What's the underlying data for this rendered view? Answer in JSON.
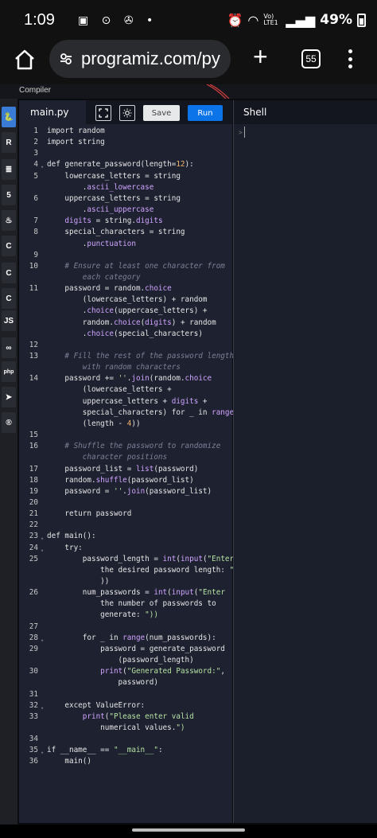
{
  "status_bar": {
    "time": "1:09",
    "left_icons": "▣ ⊙ ✇ •",
    "network": "Vo) LTE1",
    "battery": "49%"
  },
  "browser": {
    "url": "programiz.com/py",
    "tab_count": "55"
  },
  "compiler_label": "Compiler",
  "editor": {
    "file_tab": "main.py",
    "save_label": "Save",
    "run_label": "Run",
    "lines": [
      {
        "n": "1",
        "t": "import random"
      },
      {
        "n": "2",
        "t": "import string"
      },
      {
        "n": "3",
        "t": ""
      },
      {
        "n": "4",
        "t": "def generate_password(length=12):",
        "fold": true
      },
      {
        "n": "5",
        "t": "    lowercase_letters = string"
      },
      {
        "n": "",
        "t": "        .ascii_lowercase"
      },
      {
        "n": "6",
        "t": "    uppercase_letters = string"
      },
      {
        "n": "",
        "t": "        .ascii_uppercase"
      },
      {
        "n": "7",
        "t": "    digits = string.digits"
      },
      {
        "n": "8",
        "t": "    special_characters = string"
      },
      {
        "n": "",
        "t": "        .punctuation"
      },
      {
        "n": "9",
        "t": ""
      },
      {
        "n": "10",
        "t": "    # Ensure at least one character from"
      },
      {
        "n": "",
        "t": "        each category"
      },
      {
        "n": "11",
        "t": "    password = random.choice"
      },
      {
        "n": "",
        "t": "        (lowercase_letters) + random"
      },
      {
        "n": "",
        "t": "        .choice(uppercase_letters) +"
      },
      {
        "n": "",
        "t": "        random.choice(digits) + random"
      },
      {
        "n": "",
        "t": "        .choice(special_characters)"
      },
      {
        "n": "12",
        "t": ""
      },
      {
        "n": "13",
        "t": "    # Fill the rest of the password length"
      },
      {
        "n": "",
        "t": "        with random characters"
      },
      {
        "n": "14",
        "t": "    password += ''.join(random.choice"
      },
      {
        "n": "",
        "t": "        (lowercase_letters +"
      },
      {
        "n": "",
        "t": "        uppercase_letters + digits +"
      },
      {
        "n": "",
        "t": "        special_characters) for _ in range"
      },
      {
        "n": "",
        "t": "        (length - 4))"
      },
      {
        "n": "15",
        "t": ""
      },
      {
        "n": "16",
        "t": "    # Shuffle the password to randomize"
      },
      {
        "n": "",
        "t": "        character positions"
      },
      {
        "n": "17",
        "t": "    password_list = list(password)"
      },
      {
        "n": "18",
        "t": "    random.shuffle(password_list)"
      },
      {
        "n": "19",
        "t": "    password = ''.join(password_list)"
      },
      {
        "n": "20",
        "t": ""
      },
      {
        "n": "21",
        "t": "    return password"
      },
      {
        "n": "22",
        "t": ""
      },
      {
        "n": "23",
        "t": "def main():",
        "fold": true
      },
      {
        "n": "24",
        "t": "    try:",
        "fold": true
      },
      {
        "n": "25",
        "t": "        password_length = int(input(\"Enter"
      },
      {
        "n": "",
        "t": "            the desired password length: \""
      },
      {
        "n": "",
        "t": "            ))"
      },
      {
        "n": "26",
        "t": "        num_passwords = int(input(\"Enter"
      },
      {
        "n": "",
        "t": "            the number of passwords to"
      },
      {
        "n": "",
        "t": "            generate: \"))"
      },
      {
        "n": "27",
        "t": ""
      },
      {
        "n": "28",
        "t": "        for _ in range(num_passwords):",
        "fold": true
      },
      {
        "n": "29",
        "t": "            password = generate_password"
      },
      {
        "n": "",
        "t": "                (password_length)"
      },
      {
        "n": "30",
        "t": "            print(\"Generated Password:\","
      },
      {
        "n": "",
        "t": "                password)"
      },
      {
        "n": "31",
        "t": ""
      },
      {
        "n": "32",
        "t": "    except ValueError:",
        "fold": true
      },
      {
        "n": "33",
        "t": "        print(\"Please enter valid"
      },
      {
        "n": "",
        "t": "            numerical values.\")"
      },
      {
        "n": "34",
        "t": ""
      },
      {
        "n": "35",
        "t": "if __name__ == \"__main__\":",
        "fold": true
      },
      {
        "n": "36",
        "t": "    main()"
      }
    ]
  },
  "shell": {
    "label": "Shell",
    "prompt": ">"
  },
  "sidebar_languages": [
    {
      "name": "python-icon",
      "glyph": "🐍",
      "active": true
    },
    {
      "name": "r-icon",
      "glyph": "R"
    },
    {
      "name": "sql-icon",
      "glyph": "≣"
    },
    {
      "name": "html-icon",
      "glyph": "5"
    },
    {
      "name": "java-icon",
      "glyph": "♨"
    },
    {
      "name": "c-icon",
      "glyph": "C"
    },
    {
      "name": "cpp-icon",
      "glyph": "C"
    },
    {
      "name": "csharp-icon",
      "glyph": "C"
    },
    {
      "name": "js-icon",
      "glyph": "JS"
    },
    {
      "name": "go-icon",
      "glyph": "∞"
    },
    {
      "name": "php-icon",
      "glyph": "php"
    },
    {
      "name": "swift-icon",
      "glyph": "➤"
    },
    {
      "name": "rust-icon",
      "glyph": "®"
    }
  ],
  "colors": {
    "accent": "#0a74e8",
    "editor_bg": "#1e2130",
    "keyword": "#cfa4ff",
    "string": "#b6e3a3",
    "number": "#f0b36d",
    "comment": "#7c8096"
  }
}
